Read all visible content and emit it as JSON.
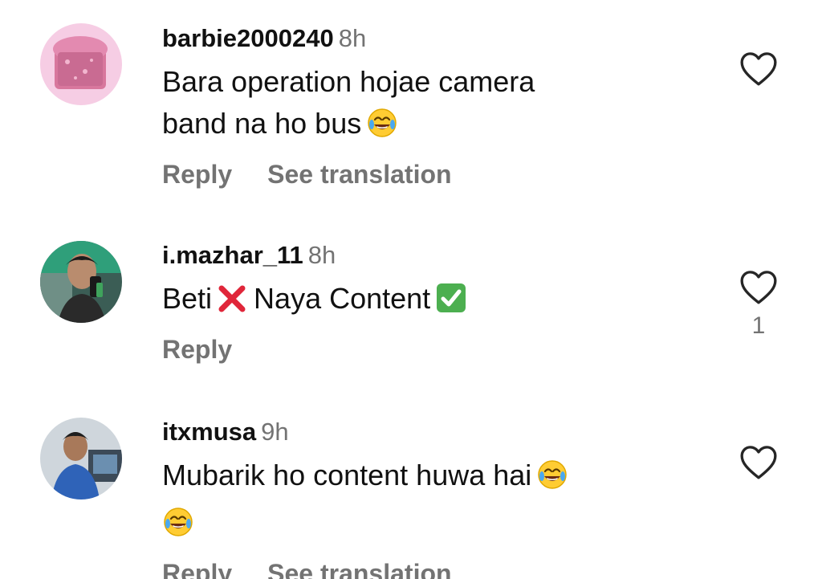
{
  "comments": [
    {
      "username": "barbie2000240",
      "time": "8h",
      "text_line1": "Bara operation hojae camera",
      "text_line2": "band na ho bus",
      "emoji": "joy-emoji",
      "reply_label": "Reply",
      "translation_label": "See translation",
      "like_icon": "heart-outline-icon"
    },
    {
      "username": "i.mazhar_11",
      "time": "8h",
      "text_part1": "Beti",
      "text_part2": "Naya Content",
      "emoji_cross": "cross-mark-emoji",
      "emoji_check": "check-mark-emoji",
      "reply_label": "Reply",
      "like_icon": "heart-outline-icon",
      "like_count": "1"
    },
    {
      "username": "itxmusa",
      "time": "9h",
      "text_line1": "Mubarik ho content huwa hai",
      "emoji": "joy-emoji",
      "reply_label": "Reply",
      "translation_label": "See translation",
      "like_icon": "heart-outline-icon"
    }
  ],
  "colors": {
    "text": "#111111",
    "secondary": "#737373",
    "cross": "#e0263a",
    "check": "#4caf50"
  }
}
